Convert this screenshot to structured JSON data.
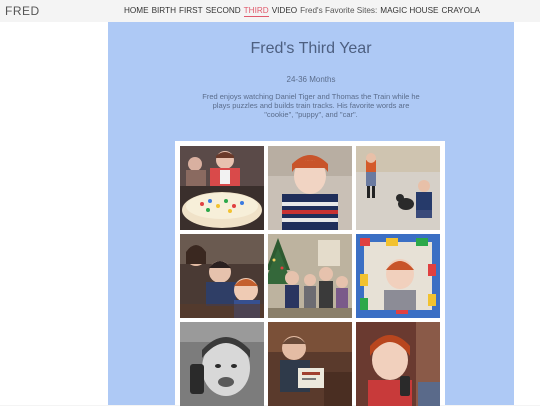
{
  "brand": "FRED",
  "nav": {
    "items": [
      "HOME",
      "BIRTH",
      "FIRST",
      "SECOND",
      "THIRD",
      "VIDEO"
    ],
    "active": "THIRD",
    "sites_label": "Fred's Favorite Sites:",
    "sites": [
      "MAGIC HOUSE",
      "CRAYOLA"
    ],
    "accent_color": "#e05b6d"
  },
  "page": {
    "title": "Fred's Third Year",
    "subtitle": "24-36 Months",
    "description": "Fred enjoys watching Daniel Tiger and Thomas the Train while he plays puzzles and builds train tracks. His favorite words are \"cookie\", \"puppy\", and \"car\"."
  },
  "gallery": {
    "photos": [
      {
        "name": "photo-birthday-cake"
      },
      {
        "name": "photo-striped-shirt"
      },
      {
        "name": "photo-driveway-dog"
      },
      {
        "name": "photo-family-couch"
      },
      {
        "name": "photo-christmas-family"
      },
      {
        "name": "photo-lego-frame"
      },
      {
        "name": "photo-black-white-phone"
      },
      {
        "name": "photo-reading-book"
      },
      {
        "name": "photo-red-hair-phone"
      }
    ]
  },
  "colors": {
    "content_bg": "#aec9f5",
    "page_bg": "#f4f4f4"
  }
}
